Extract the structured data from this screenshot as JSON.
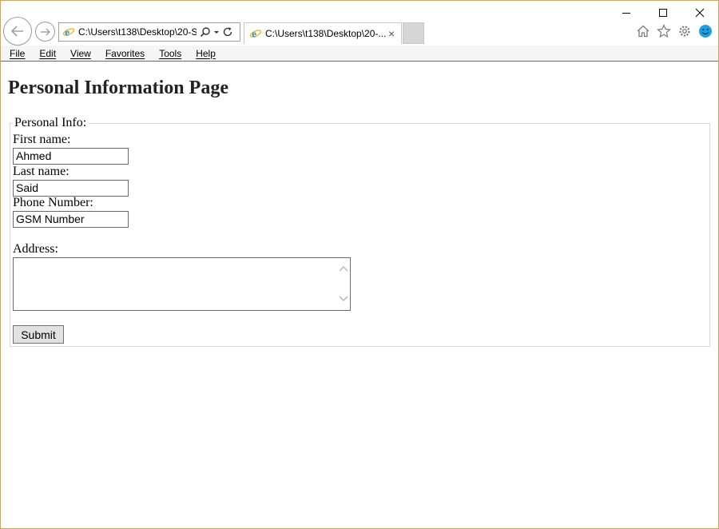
{
  "browser": {
    "address_url": "C:\\Users\\t138\\Desktop\\20-S",
    "tab_title": "C:\\Users\\t138\\Desktop\\20-...",
    "tab_close": "×",
    "menu": [
      "File",
      "Edit",
      "View",
      "Favorites",
      "Tools",
      "Help"
    ]
  },
  "page": {
    "heading": "Personal Information Page",
    "form": {
      "legend": "Personal Info:",
      "first_name_label": "First name:",
      "first_name_value": "Ahmed",
      "last_name_label": "Last name:",
      "last_name_value": "Said",
      "phone_label": "Phone Number:",
      "phone_value": "GSM Number",
      "address_label": "Address:",
      "address_value": "",
      "submit_label": "Submit"
    }
  },
  "icons": {
    "back": "back-arrow-icon",
    "forward": "forward-arrow-icon",
    "ie": "ie-logo-icon",
    "search": "search-icon",
    "refresh": "refresh-icon",
    "home": "home-icon",
    "favorites": "star-icon",
    "settings": "gear-icon",
    "feedback": "smiley-icon"
  },
  "colors": {
    "window_border": "#d9a441",
    "ie_blue": "#1c8fd6",
    "ie_orange": "#f2b420",
    "smiley": "#1ba1e2"
  }
}
